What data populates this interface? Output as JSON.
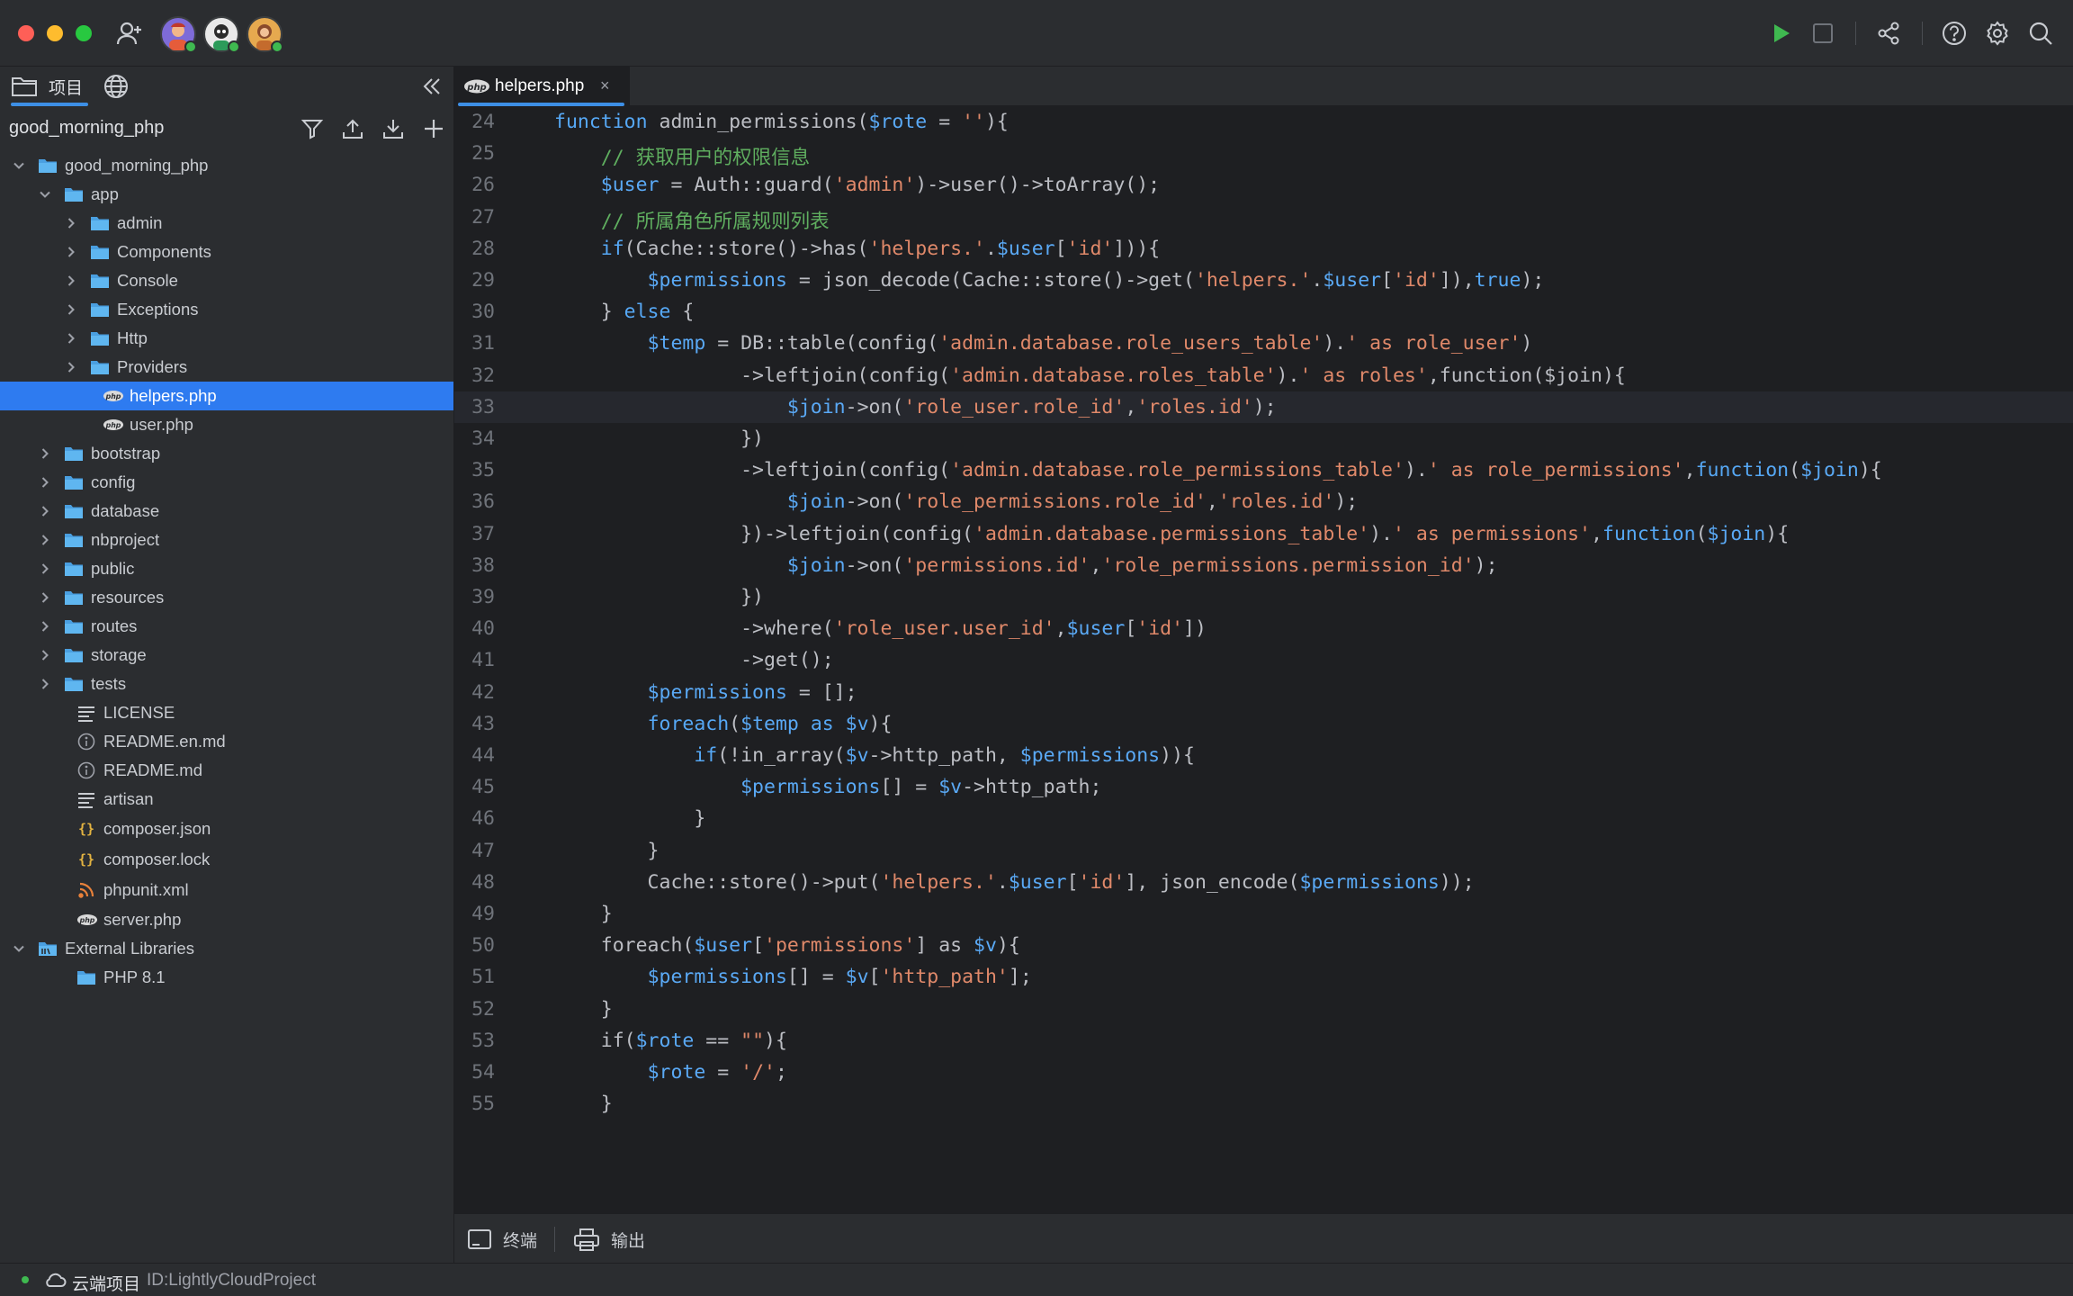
{
  "titlebar": {
    "users": [
      {
        "name": "avatar-user-1",
        "bg": "#7e6bd8"
      },
      {
        "name": "avatar-user-2",
        "bg": "#e9e9e9"
      },
      {
        "name": "avatar-user-3",
        "bg": "#e6a94f"
      }
    ]
  },
  "sidebar": {
    "tabs": [
      {
        "label": "项目"
      },
      {
        "label": ""
      }
    ],
    "project_name": "good_morning_php",
    "tree": [
      {
        "label": "good_morning_php",
        "type": "folder",
        "depth": 0,
        "expanded": true
      },
      {
        "label": "app",
        "type": "folder",
        "depth": 1,
        "expanded": true
      },
      {
        "label": "admin",
        "type": "folder",
        "depth": 2,
        "expanded": false
      },
      {
        "label": "Components",
        "type": "folder",
        "depth": 2,
        "expanded": false
      },
      {
        "label": "Console",
        "type": "folder",
        "depth": 2,
        "expanded": false
      },
      {
        "label": "Exceptions",
        "type": "folder",
        "depth": 2,
        "expanded": false
      },
      {
        "label": "Http",
        "type": "folder",
        "depth": 2,
        "expanded": false
      },
      {
        "label": "Providers",
        "type": "folder",
        "depth": 2,
        "expanded": false
      },
      {
        "label": "helpers.php",
        "type": "php",
        "depth": 3,
        "selected": true
      },
      {
        "label": "user.php",
        "type": "php",
        "depth": 3
      },
      {
        "label": "bootstrap",
        "type": "folder",
        "depth": 1,
        "expanded": false
      },
      {
        "label": "config",
        "type": "folder",
        "depth": 1,
        "expanded": false
      },
      {
        "label": "database",
        "type": "folder",
        "depth": 1,
        "expanded": false
      },
      {
        "label": "nbproject",
        "type": "folder",
        "depth": 1,
        "expanded": false
      },
      {
        "label": "public",
        "type": "folder",
        "depth": 1,
        "expanded": false
      },
      {
        "label": "resources",
        "type": "folder",
        "depth": 1,
        "expanded": false
      },
      {
        "label": "routes",
        "type": "folder",
        "depth": 1,
        "expanded": false
      },
      {
        "label": "storage",
        "type": "folder",
        "depth": 1,
        "expanded": false
      },
      {
        "label": "tests",
        "type": "folder",
        "depth": 1,
        "expanded": false
      },
      {
        "label": "LICENSE",
        "type": "text",
        "depth": 2
      },
      {
        "label": "README.en.md",
        "type": "info",
        "depth": 2
      },
      {
        "label": "README.md",
        "type": "info",
        "depth": 2
      },
      {
        "label": "artisan",
        "type": "text",
        "depth": 2
      },
      {
        "label": "composer.json",
        "type": "json",
        "depth": 2
      },
      {
        "label": "composer.lock",
        "type": "json",
        "depth": 2
      },
      {
        "label": "phpunit.xml",
        "type": "rss",
        "depth": 2
      },
      {
        "label": "server.php",
        "type": "php",
        "depth": 2
      },
      {
        "label": "External Libraries",
        "type": "library",
        "depth": 0,
        "expanded": true
      },
      {
        "label": "PHP 8.1",
        "type": "folder",
        "depth": 2
      }
    ]
  },
  "editor": {
    "tab_label": "helpers.php",
    "tab_close": "×",
    "current_line": 33,
    "lines": [
      {
        "n": "24",
        "tokens": [
          [
            "kw",
            "function"
          ],
          [
            "plain",
            " admin_permissions("
          ],
          [
            "var",
            "$rote"
          ],
          [
            "plain",
            " = "
          ],
          [
            "str",
            "''"
          ],
          [
            "plain",
            "){"
          ]
        ]
      },
      {
        "n": "25",
        "tokens": [
          [
            "plain",
            "    "
          ],
          [
            "cm",
            "// 获取用户的权限信息"
          ]
        ]
      },
      {
        "n": "26",
        "tokens": [
          [
            "plain",
            "    "
          ],
          [
            "var",
            "$user"
          ],
          [
            "plain",
            " = Auth::guard("
          ],
          [
            "str",
            "'admin'"
          ],
          [
            "plain",
            ")->user()->toArray();"
          ]
        ]
      },
      {
        "n": "27",
        "tokens": [
          [
            "plain",
            "    "
          ],
          [
            "cm",
            "// 所属角色所属规则列表"
          ]
        ]
      },
      {
        "n": "28",
        "tokens": [
          [
            "plain",
            "    "
          ],
          [
            "kw",
            "if"
          ],
          [
            "plain",
            "(Cache::store()->has("
          ],
          [
            "str",
            "'helpers.'"
          ],
          [
            "plain",
            "."
          ],
          [
            "var",
            "$user"
          ],
          [
            "plain",
            "["
          ],
          [
            "str",
            "'id'"
          ],
          [
            "plain",
            "])){"
          ]
        ]
      },
      {
        "n": "29",
        "tokens": [
          [
            "plain",
            "        "
          ],
          [
            "var",
            "$permissions"
          ],
          [
            "plain",
            " = json_decode(Cache::store()->get("
          ],
          [
            "str",
            "'helpers.'"
          ],
          [
            "plain",
            "."
          ],
          [
            "var",
            "$user"
          ],
          [
            "plain",
            "["
          ],
          [
            "str",
            "'id'"
          ],
          [
            "plain",
            "]),"
          ],
          [
            "bool",
            "true"
          ],
          [
            "plain",
            ");"
          ]
        ]
      },
      {
        "n": "30",
        "tokens": [
          [
            "plain",
            "    } "
          ],
          [
            "kw",
            "else"
          ],
          [
            "plain",
            " {"
          ]
        ]
      },
      {
        "n": "31",
        "tokens": [
          [
            "plain",
            "        "
          ],
          [
            "var",
            "$temp"
          ],
          [
            "plain",
            " = DB::table(config("
          ],
          [
            "str",
            "'admin.database.role_users_table'"
          ],
          [
            "plain",
            ")."
          ],
          [
            "str",
            "' as role_user'"
          ],
          [
            "plain",
            ")"
          ]
        ]
      },
      {
        "n": "32",
        "tokens": [
          [
            "plain",
            "                ->leftjoin(config("
          ],
          [
            "str",
            "'admin.database.roles_table'"
          ],
          [
            "plain",
            ")."
          ],
          [
            "str",
            "' as roles'"
          ],
          [
            "plain",
            ",function($join){"
          ]
        ]
      },
      {
        "n": "33",
        "tokens": [
          [
            "plain",
            "                    "
          ],
          [
            "var",
            "$join"
          ],
          [
            "plain",
            "->on("
          ],
          [
            "str",
            "'role_user.role_id'"
          ],
          [
            "plain",
            ","
          ],
          [
            "str",
            "'roles.id'"
          ],
          [
            "plain",
            ");"
          ]
        ]
      },
      {
        "n": "34",
        "tokens": [
          [
            "plain",
            "                })"
          ]
        ]
      },
      {
        "n": "35",
        "tokens": [
          [
            "plain",
            "                ->leftjoin(config("
          ],
          [
            "str",
            "'admin.database.role_permissions_table'"
          ],
          [
            "plain",
            ")."
          ],
          [
            "str",
            "' as role_permissions'"
          ],
          [
            "plain",
            ","
          ],
          [
            "kw",
            "function"
          ],
          [
            "plain",
            "("
          ],
          [
            "var",
            "$join"
          ],
          [
            "plain",
            "){"
          ]
        ]
      },
      {
        "n": "36",
        "tokens": [
          [
            "plain",
            "                    "
          ],
          [
            "var",
            "$join"
          ],
          [
            "plain",
            "->on("
          ],
          [
            "str",
            "'role_permissions.role_id'"
          ],
          [
            "plain",
            ","
          ],
          [
            "str",
            "'roles.id'"
          ],
          [
            "plain",
            ");"
          ]
        ]
      },
      {
        "n": "37",
        "tokens": [
          [
            "plain",
            "                })->leftjoin(config("
          ],
          [
            "str",
            "'admin.database.permissions_table'"
          ],
          [
            "plain",
            ")."
          ],
          [
            "str",
            "' as permissions'"
          ],
          [
            "plain",
            ","
          ],
          [
            "kw",
            "function"
          ],
          [
            "plain",
            "("
          ],
          [
            "var",
            "$join"
          ],
          [
            "plain",
            "){"
          ]
        ]
      },
      {
        "n": "38",
        "tokens": [
          [
            "plain",
            "                    "
          ],
          [
            "var",
            "$join"
          ],
          [
            "plain",
            "->on("
          ],
          [
            "str",
            "'permissions.id'"
          ],
          [
            "plain",
            ","
          ],
          [
            "str",
            "'role_permissions.permission_id'"
          ],
          [
            "plain",
            ");"
          ]
        ]
      },
      {
        "n": "39",
        "tokens": [
          [
            "plain",
            "                })"
          ]
        ]
      },
      {
        "n": "40",
        "tokens": [
          [
            "plain",
            "                ->where("
          ],
          [
            "str",
            "'role_user.user_id'"
          ],
          [
            "plain",
            ","
          ],
          [
            "var",
            "$user"
          ],
          [
            "plain",
            "["
          ],
          [
            "str",
            "'id'"
          ],
          [
            "plain",
            "])"
          ]
        ]
      },
      {
        "n": "41",
        "tokens": [
          [
            "plain",
            "                ->get();"
          ]
        ]
      },
      {
        "n": "42",
        "tokens": [
          [
            "plain",
            "        "
          ],
          [
            "var",
            "$permissions"
          ],
          [
            "plain",
            " = [];"
          ]
        ]
      },
      {
        "n": "43",
        "tokens": [
          [
            "plain",
            "        "
          ],
          [
            "kw",
            "foreach"
          ],
          [
            "plain",
            "("
          ],
          [
            "var",
            "$temp"
          ],
          [
            "plain",
            " "
          ],
          [
            "kw",
            "as"
          ],
          [
            "plain",
            " "
          ],
          [
            "var",
            "$v"
          ],
          [
            "plain",
            "){"
          ]
        ]
      },
      {
        "n": "44",
        "tokens": [
          [
            "plain",
            "            "
          ],
          [
            "kw",
            "if"
          ],
          [
            "plain",
            "(!in_array("
          ],
          [
            "var",
            "$v"
          ],
          [
            "plain",
            "->http_path, "
          ],
          [
            "var",
            "$permissions"
          ],
          [
            "plain",
            ")){"
          ]
        ]
      },
      {
        "n": "45",
        "tokens": [
          [
            "plain",
            "                "
          ],
          [
            "var",
            "$permissions"
          ],
          [
            "plain",
            "[] = "
          ],
          [
            "var",
            "$v"
          ],
          [
            "plain",
            "->http_path;"
          ]
        ]
      },
      {
        "n": "46",
        "tokens": [
          [
            "plain",
            "            }"
          ]
        ]
      },
      {
        "n": "47",
        "tokens": [
          [
            "plain",
            "        }"
          ]
        ]
      },
      {
        "n": "48",
        "tokens": [
          [
            "plain",
            "        Cache::store()->put("
          ],
          [
            "str",
            "'helpers.'"
          ],
          [
            "plain",
            "."
          ],
          [
            "var",
            "$user"
          ],
          [
            "plain",
            "["
          ],
          [
            "str",
            "'id'"
          ],
          [
            "plain",
            "], json_encode("
          ],
          [
            "var",
            "$permissions"
          ],
          [
            "plain",
            "));"
          ]
        ]
      },
      {
        "n": "49",
        "tokens": [
          [
            "plain",
            "    }"
          ]
        ]
      },
      {
        "n": "50",
        "tokens": [
          [
            "plain",
            "    foreach("
          ],
          [
            "var",
            "$user"
          ],
          [
            "plain",
            "["
          ],
          [
            "str",
            "'permissions'"
          ],
          [
            "plain",
            "] as "
          ],
          [
            "var",
            "$v"
          ],
          [
            "plain",
            "){"
          ]
        ]
      },
      {
        "n": "51",
        "tokens": [
          [
            "plain",
            "        "
          ],
          [
            "var",
            "$permissions"
          ],
          [
            "plain",
            "[] = "
          ],
          [
            "var",
            "$v"
          ],
          [
            "plain",
            "["
          ],
          [
            "str",
            "'http_path'"
          ],
          [
            "plain",
            "];"
          ]
        ]
      },
      {
        "n": "52",
        "tokens": [
          [
            "plain",
            "    }"
          ]
        ]
      },
      {
        "n": "53",
        "tokens": [
          [
            "plain",
            "    if("
          ],
          [
            "var",
            "$rote"
          ],
          [
            "plain",
            " == "
          ],
          [
            "str",
            "\"\""
          ],
          [
            "plain",
            "){"
          ]
        ]
      },
      {
        "n": "54",
        "tokens": [
          [
            "plain",
            "        "
          ],
          [
            "var",
            "$rote"
          ],
          [
            "plain",
            " = "
          ],
          [
            "str",
            "'/'"
          ],
          [
            "plain",
            ";"
          ]
        ]
      },
      {
        "n": "55",
        "tokens": [
          [
            "plain",
            "    }"
          ]
        ]
      }
    ]
  },
  "bottombar": {
    "terminal_label": "终端",
    "output_label": "输出"
  },
  "statusbar": {
    "cloud_label": "云端项目",
    "project_id": "ID:LightlyCloudProject"
  },
  "colors": {
    "accent": "#3d8fe6",
    "selection": "#2e7bf0",
    "folder": "#5fb6f0",
    "run": "#3fb950"
  }
}
